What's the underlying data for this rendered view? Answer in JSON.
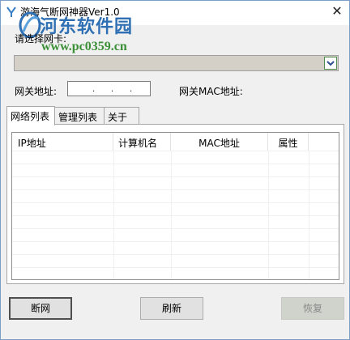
{
  "window": {
    "title": "游海气断网神器Ver1.0",
    "close_glyph": "✕"
  },
  "watermark": {
    "text": "河东软件园",
    "url": "www.pc0359.cn"
  },
  "nic": {
    "label": "请选择网卡:",
    "selected": ""
  },
  "gateway": {
    "address_label": "网关地址:",
    "address_value": ". . .",
    "mac_label": "网关MAC地址:",
    "mac_value": ""
  },
  "tabs": [
    {
      "label": "网络列表",
      "active": true
    },
    {
      "label": "管理列表",
      "active": false
    },
    {
      "label": "关于",
      "active": false
    }
  ],
  "table": {
    "columns": [
      "IP地址",
      "计算机名",
      "MAC地址",
      "属性"
    ],
    "rows": []
  },
  "buttons": {
    "disconnect": "断网",
    "refresh": "刷新",
    "restore": "恢复"
  },
  "colors": {
    "watermark_blue": "#2f6fb3",
    "watermark_green": "#3b8f36",
    "select_arrow_border": "#4f8a4f"
  }
}
